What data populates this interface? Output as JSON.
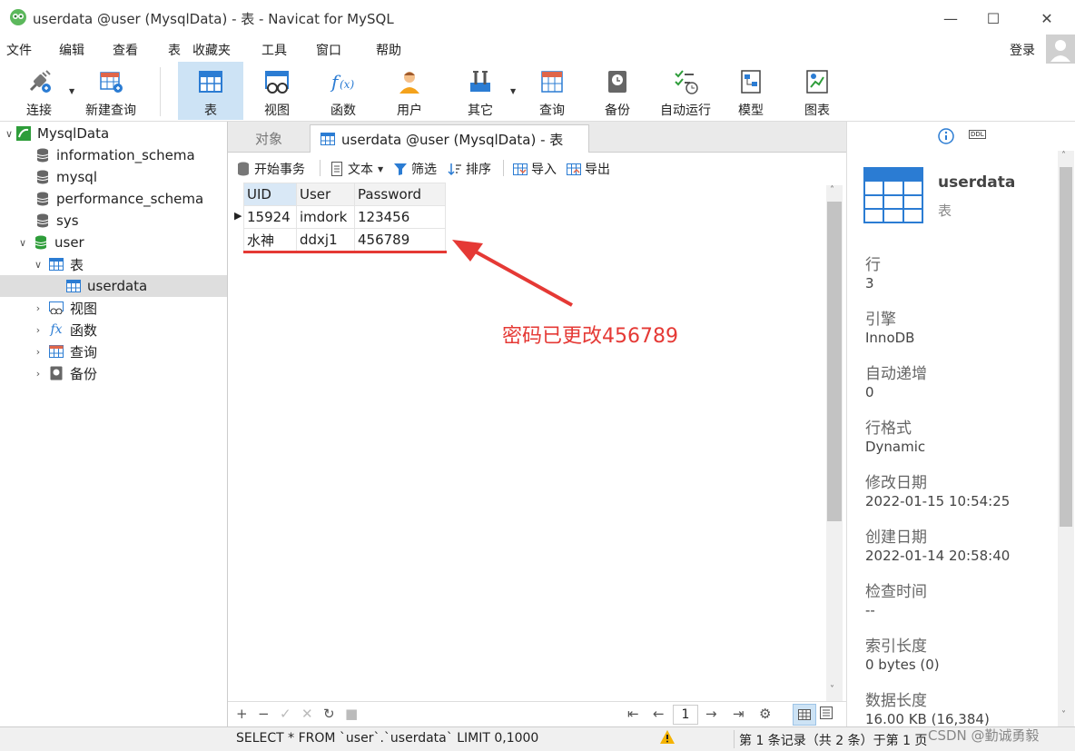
{
  "window": {
    "title": "userdata @user (MysqlData) - 表 - Navicat for MySQL",
    "min_icon": "minimize-icon",
    "max_icon": "maximize-icon",
    "close_icon": "close-icon"
  },
  "menu": [
    "文件",
    "编辑",
    "查看",
    "表",
    "收藏夹",
    "工具",
    "窗口",
    "帮助"
  ],
  "login_label": "登录",
  "toolbar": {
    "connect": "连接",
    "new_query": "新建查询",
    "table": "表",
    "view": "视图",
    "function": "函数",
    "user": "用户",
    "other": "其它",
    "query": "查询",
    "backup": "备份",
    "automation": "自动运行",
    "model": "模型",
    "chart": "图表"
  },
  "tree": {
    "root": "MysqlData",
    "dbs": [
      "information_schema",
      "mysql",
      "performance_schema",
      "sys"
    ],
    "user_db": "user",
    "tables_node": "表",
    "table_item": "userdata",
    "views": "视图",
    "functions": "函数",
    "queries": "查询",
    "backups": "备份"
  },
  "tabs": {
    "objects": "对象",
    "active": "userdata @user (MysqlData) - 表"
  },
  "obj_toolbar": {
    "begin_tx": "开始事务",
    "text": "文本",
    "filter": "筛选",
    "sort": "排序",
    "import": "导入",
    "export": "导出"
  },
  "grid": {
    "columns": [
      "UID",
      "User",
      "Password"
    ],
    "rows": [
      [
        "15924",
        "imdork",
        "123456"
      ],
      [
        "水神",
        "ddxj1",
        "456789"
      ]
    ]
  },
  "annotation": {
    "text": "密码已更改456789",
    "color": "#e53935"
  },
  "bottom": {
    "page": "1"
  },
  "status": {
    "sql": "SELECT * FROM `user`.`userdata` LIMIT 0,1000",
    "records": "第 1 条记录（共 2 条）于第 1 页",
    "watermark": "CSDN @勤诚勇毅"
  },
  "info": {
    "name": "userdata",
    "type": "表",
    "fields": [
      {
        "label": "行",
        "value": "3"
      },
      {
        "label": "引擎",
        "value": "InnoDB"
      },
      {
        "label": "自动递增",
        "value": "0"
      },
      {
        "label": "行格式",
        "value": "Dynamic"
      },
      {
        "label": "修改日期",
        "value": "2022-01-15 10:54:25"
      },
      {
        "label": "创建日期",
        "value": "2022-01-14 20:58:40"
      },
      {
        "label": "检查时间",
        "value": "--"
      },
      {
        "label": "索引长度",
        "value": "0 bytes (0)"
      },
      {
        "label": "数据长度",
        "value": "16.00 KB (16,384)"
      }
    ]
  },
  "colors": {
    "accent": "#2b7cd3",
    "selection": "#cde3f5",
    "db_green": "#2e9d3a"
  }
}
